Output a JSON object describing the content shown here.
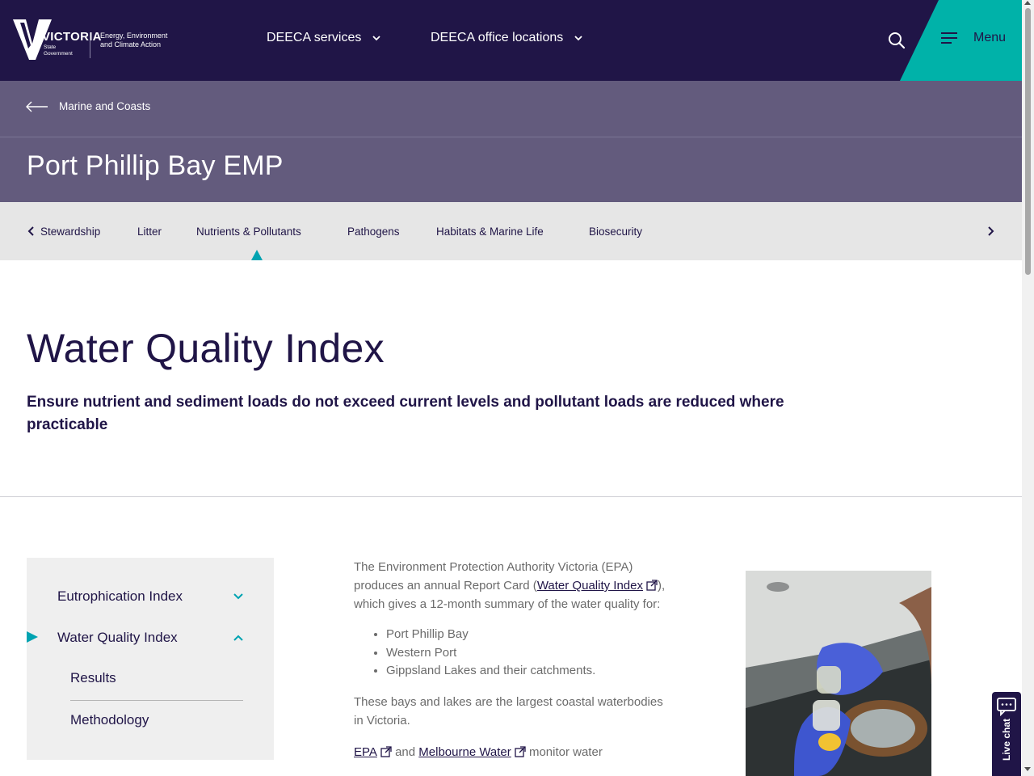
{
  "header": {
    "logo": {
      "wordmark": "VICTORIA",
      "sub": "State Government",
      "department": "Energy, Environment and Climate Action"
    },
    "nav": [
      {
        "label": "DEECA services"
      },
      {
        "label": "DEECA office locations"
      }
    ],
    "menu_label": "Menu",
    "colors": {
      "navy": "#201547",
      "teal": "#00b2a9"
    }
  },
  "band": {
    "back_label": "Marine and Coasts",
    "title": "Port Phillip Bay EMP"
  },
  "tabs": {
    "items": [
      {
        "label": "Stewardship"
      },
      {
        "label": "Litter"
      },
      {
        "label": "Nutrients & Pollutants",
        "active": true
      },
      {
        "label": "Pathogens"
      },
      {
        "label": "Habitats & Marine Life"
      },
      {
        "label": "Biosecurity"
      }
    ]
  },
  "main": {
    "title": "Water Quality Index",
    "lead": "Ensure nutrient and sediment loads do not exceed current levels and pollutant loads are reduced where practicable"
  },
  "sidenav": {
    "items": [
      {
        "label": "Eutrophication Index",
        "expanded": false
      },
      {
        "label": "Water Quality Index",
        "expanded": true,
        "active": true
      }
    ],
    "sub_items": [
      {
        "label": "Results"
      },
      {
        "label": "Methodology"
      }
    ]
  },
  "copy": {
    "p1_before": "The Environment Protection Authority Victoria (EPA) produces an annual Report Card (",
    "p1_link": "Water Quality Index",
    "p1_after": "), which gives a 12-month summary of the water quality for:",
    "list": [
      "Port Phillip Bay",
      "Western Port",
      "Gippsland Lakes and their catchments."
    ],
    "p2": "These bays and lakes are the largest coastal waterbodies in Victoria.",
    "p3_link1": "EPA",
    "p3_mid": " and ",
    "p3_link2": "Melbourne Water",
    "p3_after": " monitor water"
  },
  "live_chat_label": "Live chat"
}
